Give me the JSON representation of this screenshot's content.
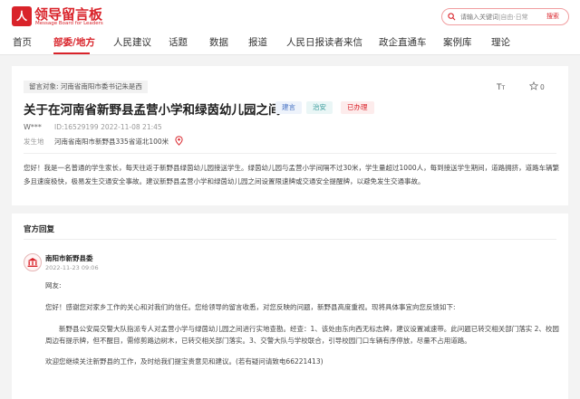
{
  "header": {
    "logo_mark": "人",
    "logo_text": "领导留言板",
    "logo_subtitle": "Message Board for Leaders",
    "search_placeholder": "请输入关键词",
    "search_scope": "|自由·日常",
    "search_button": "搜索"
  },
  "nav": {
    "items": [
      "首页",
      "部委/地方",
      "人民建议",
      "话题",
      "数据",
      "报道",
      "人民日报读者来信",
      "政企直通车",
      "案例库",
      "理论"
    ],
    "active_index": 1
  },
  "message": {
    "target": "留言对象:  河南省南阳市委书记朱是西",
    "font_size_icon": "T",
    "favorite_count": "0",
    "title": "关于在河南省新野县孟营小学和绿茵幼儿园之间",
    "badges": [
      "建言",
      "治安",
      "已办理"
    ],
    "author": "W***",
    "id_and_time": "ID:16529199    2022-11-08 21:45",
    "location_label": "发生地",
    "location": "河南省南阳市新野县335省道北100米",
    "body": "您好！我是一名普通的学生家长，每天往返于新野县绿茵幼儿园接送学生。绿茵幼儿园与孟营小学间隔不过30米，学生量超过1000人，每到接送学生期间，道路拥挤，道路车辆繁多且速度极快，极易发生交通安全事故。建议新野县孟营小学和绿茵幼儿园之间设置限速牌或交通安全提醒牌，以避免发生交通事故。"
  },
  "reply": {
    "heading": "官方回复",
    "department": "南阳市新野县委",
    "time": "2022-11-23 09:06",
    "paragraphs": [
      "网友:",
      "您好！感谢您对家乡工作的关心和对我们的信任。您给领导的留言收悉，对您反映的问题，新野县高度重视。现将具体事宜向您反馈如下:",
      "新野县公安局交警大队指派专人对孟营小学与绿茵幼儿园之间进行实地查勘。经查：1、该处由东向西无标志牌，建议设置减速带。此问题已转交相关部门落实    2、校园周边有提示牌，但不醒目，需修剪路边树木，已转交相关部门落实。3、交警大队与学校联合，引导校园门口车辆有序停放，尽量不占用道路。",
      "欢迎您继续关注新野县的工作，及时给我们提宝贵意见和建议。(若有疑问请致电66221413)"
    ]
  },
  "colors": {
    "brand_red": "#d9232a"
  }
}
